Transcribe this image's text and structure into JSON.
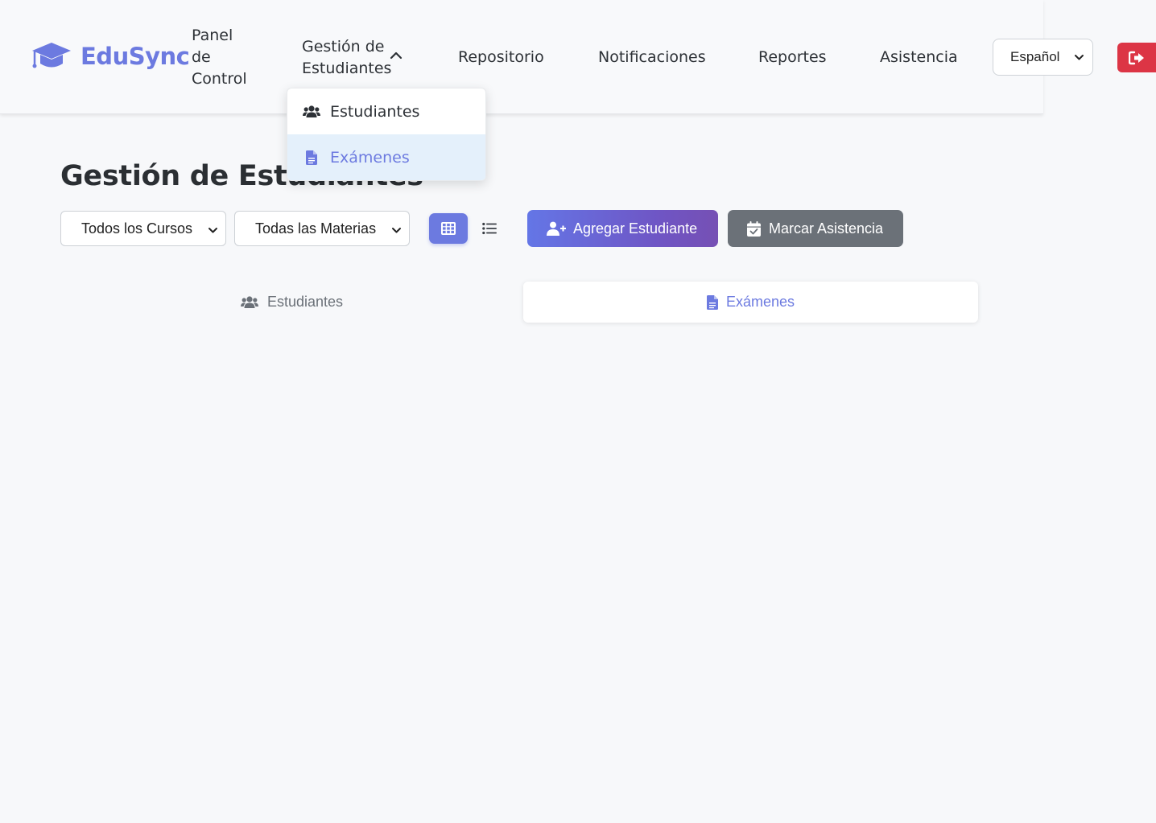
{
  "brand": {
    "name": "EduSync"
  },
  "nav": {
    "dashboard": "Panel de Control",
    "student_management": "Gestión de Estudiantes",
    "repository": "Repositorio",
    "notifications": "Notificaciones",
    "reports": "Reportes",
    "attendance": "Asistencia",
    "language": "Español"
  },
  "dropdown": {
    "items": [
      {
        "label": "Estudiantes",
        "icon": "users-icon",
        "active": false
      },
      {
        "label": "Exámenes",
        "icon": "file-icon",
        "active": true
      }
    ]
  },
  "main": {
    "title": "Gestión de Estudiantes",
    "filters": {
      "course": "Todos los Cursos",
      "subject": "Todas las Materias"
    },
    "buttons": {
      "add_student": "Agregar Estudiante",
      "mark_attendance": "Marcar Asistencia"
    },
    "tabs": [
      {
        "label": "Estudiantes",
        "active": false
      },
      {
        "label": "Exámenes",
        "active": true
      }
    ]
  },
  "colors": {
    "accent": "#6c7ae0",
    "danger": "#dc3545",
    "secondary": "#6b7178"
  }
}
